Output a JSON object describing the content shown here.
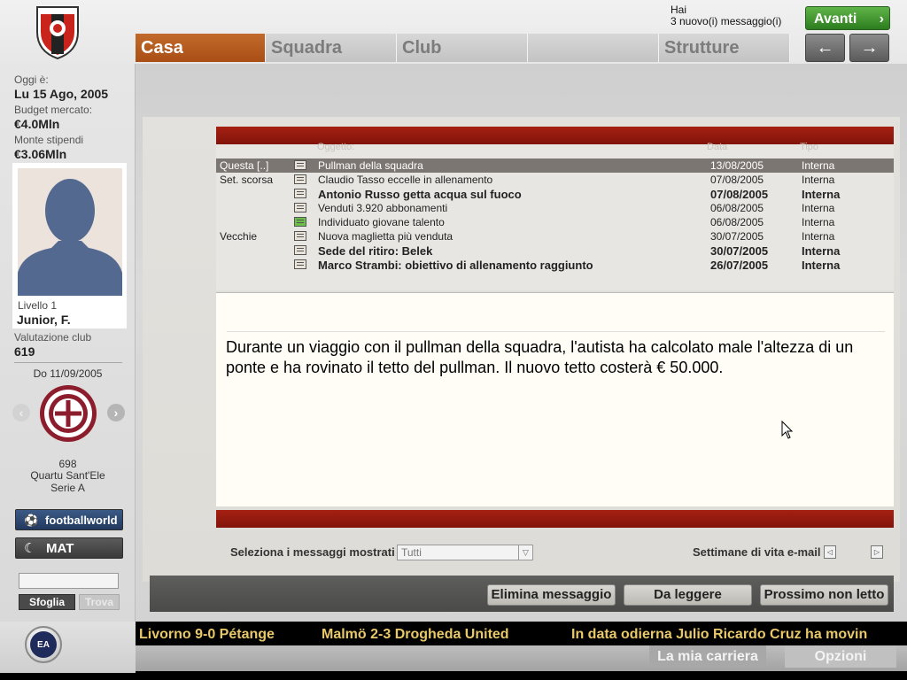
{
  "header": {
    "messages_line1": "Hai",
    "messages_line2": "3 nuovo(i) messaggio(i)",
    "next_label": "Avanti",
    "tabs": [
      {
        "label": "Casa"
      },
      {
        "label": "Squadra"
      },
      {
        "label": "Club"
      },
      {
        "label": ""
      },
      {
        "label": "Strutture"
      }
    ],
    "back_symbol": "←",
    "forward_symbol": "→"
  },
  "sidebar": {
    "today_label": "Oggi è:",
    "today_value": "Lu 15 Ago, 2005",
    "budget_label": "Budget mercato:",
    "budget_value": "€4.0Mln",
    "wages_label": "Monte stipendi",
    "wages_value": "€3.06Mln",
    "manager_level": "Livello 1",
    "manager_name": "Junior, F.",
    "club_rating_label": "Valutazione club",
    "club_rating_value": "619",
    "next_match_date": "Do 11/09/2005",
    "opponent_rating": "698",
    "opponent_name": "Quartu Sant'Ele",
    "opponent_league": "Serie A",
    "footballworld_label": "footballworld",
    "mat_label": "MAT",
    "search_value": "",
    "browse_label": "Sfoglia",
    "find_label": "Trova"
  },
  "mail": {
    "columns": {
      "subject": "Oggetto:",
      "date": "Data",
      "type": "Tipo"
    },
    "rows": [
      {
        "group": "Questa [..]",
        "subject": "Pullman della squadra",
        "date": "13/08/2005",
        "type": "Interna",
        "selected": true,
        "unread": false,
        "icon": "envelope-icon"
      },
      {
        "group": "Set. scorsa",
        "subject": "Claudio Tasso eccelle in allenamento",
        "date": "07/08/2005",
        "type": "Interna",
        "selected": false,
        "unread": false,
        "icon": "envelope-icon"
      },
      {
        "group": "",
        "subject": "Antonio Russo getta acqua sul fuoco",
        "date": "07/08/2005",
        "type": "Interna",
        "selected": false,
        "unread": true,
        "icon": "envelope-icon"
      },
      {
        "group": "",
        "subject": "Venduti 3.920 abbonamenti",
        "date": "06/08/2005",
        "type": "Interna",
        "selected": false,
        "unread": false,
        "icon": "envelope-icon"
      },
      {
        "group": "",
        "subject": "Individuato giovane talento",
        "date": "06/08/2005",
        "type": "Interna",
        "selected": false,
        "unread": false,
        "icon": "scout-envelope-icon"
      },
      {
        "group": "Vecchie",
        "subject": "Nuova maglietta più venduta",
        "date": "30/07/2005",
        "type": "Interna",
        "selected": false,
        "unread": false,
        "icon": "envelope-icon"
      },
      {
        "group": "",
        "subject": "Sede del ritiro: Belek",
        "date": "30/07/2005",
        "type": "Interna",
        "selected": false,
        "unread": true,
        "icon": "envelope-icon"
      },
      {
        "group": "",
        "subject": "Marco Strambi: obiettivo di allenamento raggiunto",
        "date": "26/07/2005",
        "type": "Interna",
        "selected": false,
        "unread": true,
        "icon": "envelope-icon"
      }
    ],
    "body": "Durante un viaggio con il pullman della squadra, l'autista ha calcolato male l'altezza di un ponte e ha rovinato il tetto del pullman. Il nuovo tetto costerà € 50.000.",
    "filter_label": "Seleziona i messaggi mostrati",
    "filter_value": "Tutti",
    "weeks_label": "Settimane di vita e-mail",
    "actions": {
      "delete": "Elimina messaggio",
      "to_read": "Da leggere",
      "next_unread": "Prossimo non letto"
    }
  },
  "ticker": {
    "items": [
      "Livorno 9-0 Pétange",
      "Malmö  2-3 Drogheda United",
      "In data odierna Julio Ricardo Cruz ha movin"
    ]
  },
  "footer": {
    "career_label": "La mia carriera",
    "options_label": "Opzioni"
  },
  "colors": {
    "active_tab": "#b15a1e",
    "header_red_bar": "#961a0e",
    "next_button": "#3e9a2e",
    "ticker_text": "#e9c86a"
  }
}
